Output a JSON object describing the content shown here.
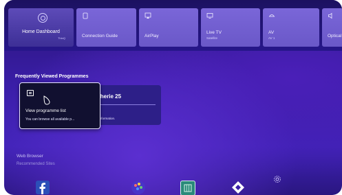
{
  "top_tiles": {
    "home": {
      "label": "Home Dashboard",
      "brand": "ThinQ"
    },
    "connection": {
      "label": "Connection Guide"
    },
    "airplay": {
      "label": "AirPlay"
    },
    "livetv": {
      "label": "Live TV",
      "sub": "Satellite"
    },
    "av": {
      "label": "AV",
      "sub": "AV 1"
    },
    "optical": {
      "label": "Optical"
    }
  },
  "frequently_viewed": {
    "title": "Frequently Viewed Programmes",
    "card_title": "Cherie 25",
    "card_info": "e information."
  },
  "tooltip": {
    "title": "View programme list",
    "body": "You can browse all available p..."
  },
  "bottom": {
    "web_browser": "Web Browser",
    "recommended": "Recommended Sites",
    "settings_icon": "gear-icon"
  },
  "colors": {
    "tile": "#7a66d8",
    "background": "#3a1ea8",
    "tooltip_bg": "#111030"
  }
}
